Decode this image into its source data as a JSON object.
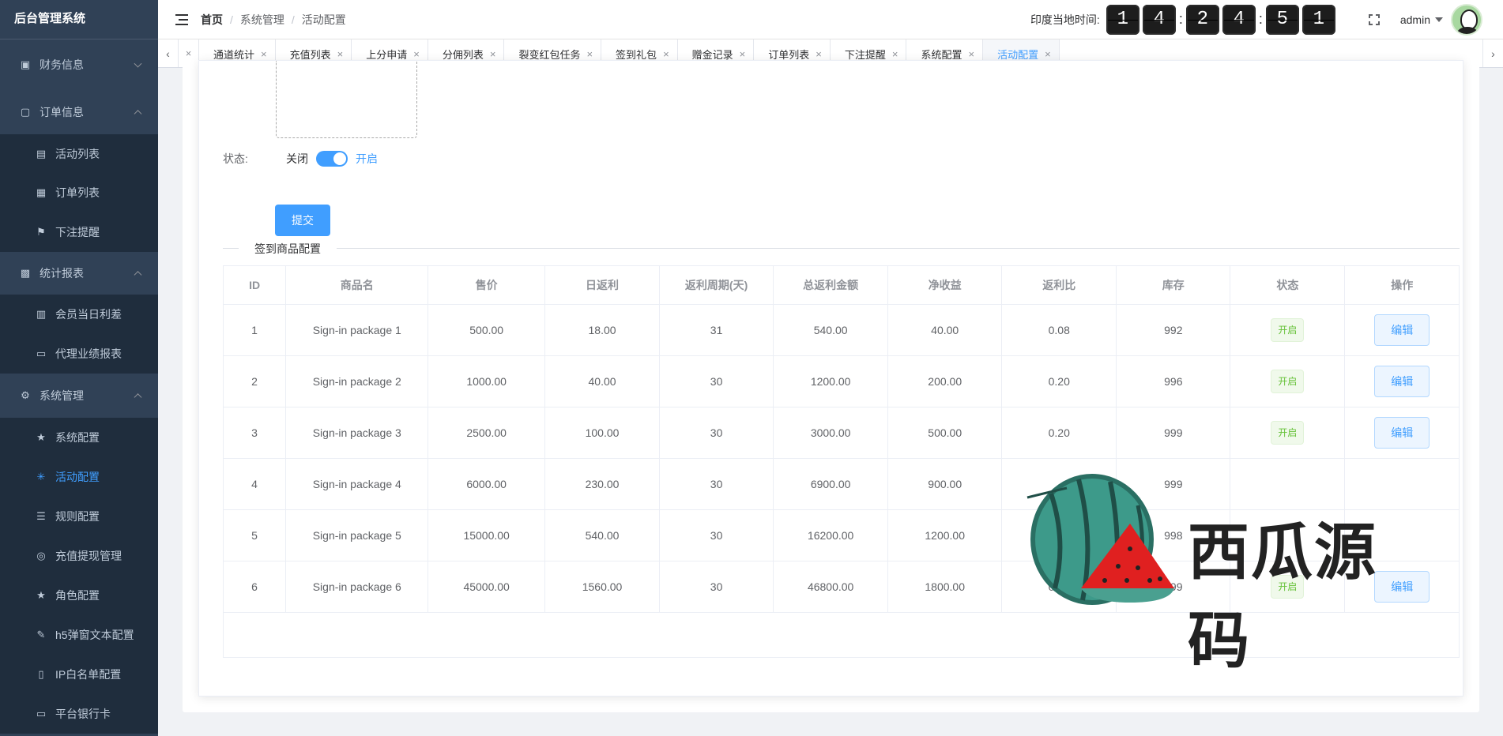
{
  "app": {
    "title": "后台管理系统"
  },
  "sidebar": {
    "items": [
      {
        "label": "财务信息",
        "icon": "bag-icon",
        "type": "group",
        "expanded": false
      },
      {
        "label": "订单信息",
        "icon": "lock-icon",
        "type": "group",
        "expanded": true
      },
      {
        "label": "活动列表",
        "icon": "document-icon",
        "type": "sub"
      },
      {
        "label": "订单列表",
        "icon": "clipboard-icon",
        "type": "sub"
      },
      {
        "label": "下注提醒",
        "icon": "flag-icon",
        "type": "sub"
      },
      {
        "label": "统计报表",
        "icon": "chart-icon",
        "type": "group",
        "expanded": true
      },
      {
        "label": "会员当日利差",
        "icon": "bar-chart-icon",
        "type": "sub"
      },
      {
        "label": "代理业绩报表",
        "icon": "presentation-icon",
        "type": "sub"
      },
      {
        "label": "系统管理",
        "icon": "gear-icon",
        "type": "group",
        "expanded": true
      },
      {
        "label": "系统配置",
        "icon": "star-icon",
        "type": "sub"
      },
      {
        "label": "活动配置",
        "icon": "loading-icon",
        "type": "sub",
        "active": true
      },
      {
        "label": "规则配置",
        "icon": "list-icon",
        "type": "sub"
      },
      {
        "label": "充值提现管理",
        "icon": "database-icon",
        "type": "sub"
      },
      {
        "label": "角色配置",
        "icon": "star-icon",
        "type": "sub"
      },
      {
        "label": "h5弹窗文本配置",
        "icon": "pen-icon",
        "type": "sub"
      },
      {
        "label": "IP白名单配置",
        "icon": "mobile-icon",
        "type": "sub"
      },
      {
        "label": "平台银行卡",
        "icon": "credit-card-icon",
        "type": "sub"
      }
    ]
  },
  "header": {
    "breadcrumb": [
      "首页",
      "系统管理",
      "活动配置"
    ],
    "time_label": "印度当地时间:",
    "time_digits": [
      "1",
      "4",
      "2",
      "4",
      "5",
      "1"
    ],
    "colon": ":",
    "user": "admin"
  },
  "tags": {
    "left_arrow": "‹",
    "right_arrow": "›",
    "first_close": "×",
    "items": [
      {
        "label": "通道统计"
      },
      {
        "label": "充值列表"
      },
      {
        "label": "上分申请"
      },
      {
        "label": "分佣列表"
      },
      {
        "label": "裂变红包任务"
      },
      {
        "label": "签到礼包"
      },
      {
        "label": "赠金记录"
      },
      {
        "label": "订单列表"
      },
      {
        "label": "下注提醒"
      },
      {
        "label": "系统配置"
      },
      {
        "label": "活动配置",
        "active": true
      }
    ],
    "close_glyph": "×"
  },
  "form": {
    "status_label": "状态:",
    "switch_off_text": "关闭",
    "switch_on_text": "开启",
    "switch_value": true,
    "submit_label": "提交"
  },
  "section": {
    "title": "签到商品配置"
  },
  "table": {
    "columns": [
      "ID",
      "商品名",
      "售价",
      "日返利",
      "返利周期(天)",
      "总返利金额",
      "净收益",
      "返利比",
      "库存",
      "状态",
      "操作"
    ],
    "rows": [
      {
        "id": "1",
        "name": "Sign-in package 1",
        "price": "500.00",
        "daily": "18.00",
        "cycle": "31",
        "total": "540.00",
        "net": "40.00",
        "ratio": "0.08",
        "stock": "992",
        "status": "开启",
        "action": "编辑"
      },
      {
        "id": "2",
        "name": "Sign-in package 2",
        "price": "1000.00",
        "daily": "40.00",
        "cycle": "30",
        "total": "1200.00",
        "net": "200.00",
        "ratio": "0.20",
        "stock": "996",
        "status": "开启",
        "action": "编辑"
      },
      {
        "id": "3",
        "name": "Sign-in package 3",
        "price": "2500.00",
        "daily": "100.00",
        "cycle": "30",
        "total": "3000.00",
        "net": "500.00",
        "ratio": "0.20",
        "stock": "999",
        "status": "开启",
        "action": "编辑"
      },
      {
        "id": "4",
        "name": "Sign-in package 4",
        "price": "6000.00",
        "daily": "230.00",
        "cycle": "30",
        "total": "6900.00",
        "net": "900.00",
        "ratio": "",
        "stock": "999",
        "status": "",
        "action": ""
      },
      {
        "id": "5",
        "name": "Sign-in package 5",
        "price": "15000.00",
        "daily": "540.00",
        "cycle": "30",
        "total": "16200.00",
        "net": "1200.00",
        "ratio": "",
        "stock": "998",
        "status": "",
        "action": ""
      },
      {
        "id": "6",
        "name": "Sign-in package 6",
        "price": "45000.00",
        "daily": "1560.00",
        "cycle": "30",
        "total": "46800.00",
        "net": "1800.00",
        "ratio": "0.04",
        "stock": "999",
        "status": "开启",
        "action": "编辑"
      }
    ]
  },
  "watermark": {
    "text": "西瓜源码"
  },
  "colors": {
    "accent": "#409eff",
    "sidebar_bg": "#304156",
    "success": "#67c23a"
  }
}
